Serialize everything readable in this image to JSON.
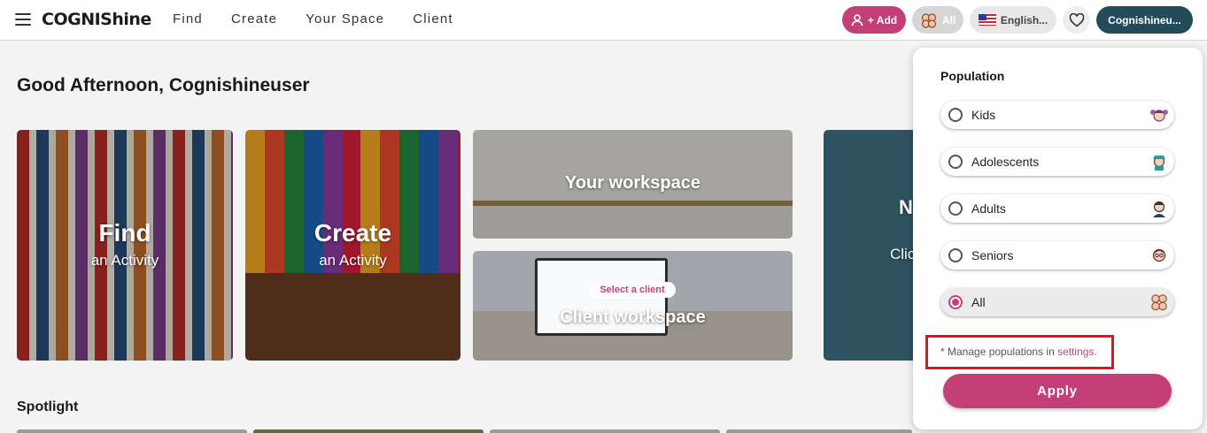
{
  "header": {
    "logo": "COGNIShine",
    "nav": [
      "Find",
      "Create",
      "Your Space",
      "Client"
    ],
    "add_label": "+ Add",
    "population_label": "All",
    "language_label": "English...",
    "user_label": "Cognishineu..."
  },
  "main": {
    "greeting": "Good Afternoon, Cognishineuser",
    "cards": {
      "find": {
        "title": "Find",
        "subtitle": "an Activity"
      },
      "create": {
        "title": "Create",
        "subtitle": "an Activity"
      },
      "workspace": {
        "title": "Your workspace"
      },
      "client": {
        "tag": "Select a client",
        "title": "Client workspace"
      },
      "next": {
        "title": "N",
        "subtitle": "Clic"
      }
    },
    "spotlight": "Spotlight"
  },
  "population_panel": {
    "title": "Population",
    "options": [
      {
        "label": "Kids",
        "selected": false,
        "icon": "kid-face-icon"
      },
      {
        "label": "Adolescents",
        "selected": false,
        "icon": "adolescent-face-icon"
      },
      {
        "label": "Adults",
        "selected": false,
        "icon": "adult-face-icon"
      },
      {
        "label": "Seniors",
        "selected": false,
        "icon": "senior-face-icon"
      },
      {
        "label": "All",
        "selected": true,
        "icon": "group-faces-icon"
      }
    ],
    "note_prefix": "* Manage populations in ",
    "note_link": "settings.",
    "apply_label": "Apply"
  },
  "colors": {
    "accent": "#c43f78",
    "dark_teal": "#244b5a",
    "highlight_box": "#e0141c"
  }
}
